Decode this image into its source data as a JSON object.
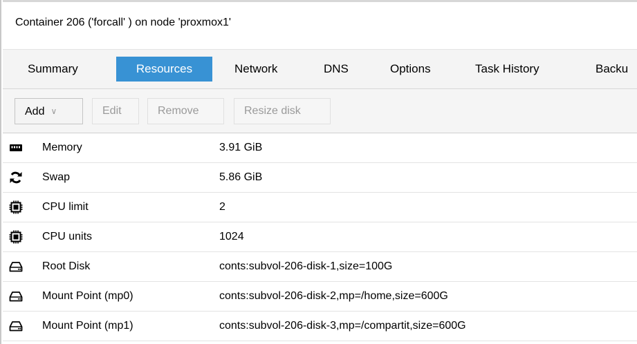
{
  "title": "Container 206 ('forcall' ) on node 'proxmox1'",
  "tabs": [
    {
      "label": "Summary",
      "active": false
    },
    {
      "label": "Resources",
      "active": true
    },
    {
      "label": "Network",
      "active": false
    },
    {
      "label": "DNS",
      "active": false
    },
    {
      "label": "Options",
      "active": false
    },
    {
      "label": "Task History",
      "active": false
    },
    {
      "label": "Backu",
      "active": false
    }
  ],
  "toolbar": {
    "add_label": "Add",
    "edit_label": "Edit",
    "remove_label": "Remove",
    "resize_label": "Resize disk"
  },
  "resources": [
    {
      "icon": "memory-icon",
      "name": "Memory",
      "value": "3.91 GiB"
    },
    {
      "icon": "swap-refresh-icon",
      "name": "Swap",
      "value": "5.86 GiB"
    },
    {
      "icon": "cpu-chip-icon",
      "name": "CPU limit",
      "value": "2"
    },
    {
      "icon": "cpu-chip-icon",
      "name": "CPU units",
      "value": "1024"
    },
    {
      "icon": "hard-drive-icon",
      "name": "Root Disk",
      "value": "conts:subvol-206-disk-1,size=100G"
    },
    {
      "icon": "hard-drive-icon",
      "name": "Mount Point (mp0)",
      "value": "conts:subvol-206-disk-2,mp=/home,size=600G"
    },
    {
      "icon": "hard-drive-icon",
      "name": "Mount Point (mp1)",
      "value": "conts:subvol-206-disk-3,mp=/compartit,size=600G"
    }
  ],
  "colors": {
    "accent": "#3892d4",
    "tab_bar_bg": "#f4f4f4",
    "toolbar_bg": "#f5f5f5",
    "disabled_text": "#9a9a9a"
  }
}
